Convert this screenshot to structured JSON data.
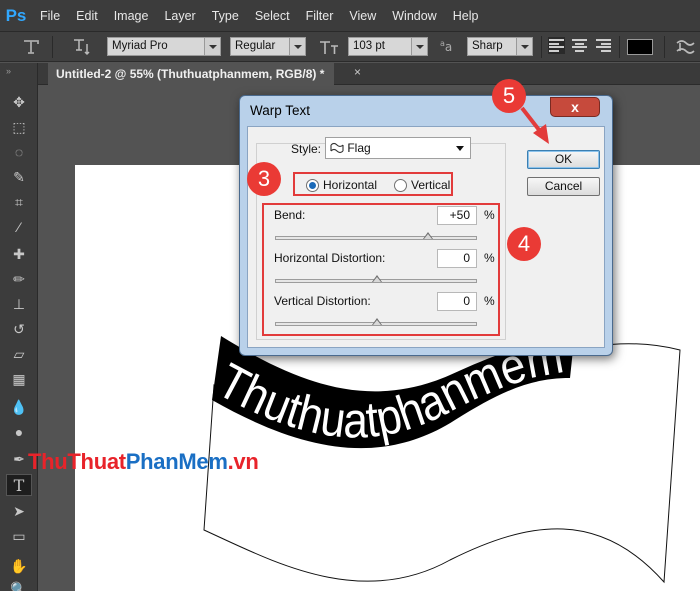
{
  "app": {
    "logo": "Ps"
  },
  "menu": [
    "File",
    "Edit",
    "Image",
    "Layer",
    "Type",
    "Select",
    "Filter",
    "View",
    "Window",
    "Help"
  ],
  "options_bar": {
    "font_family": "Myriad Pro",
    "font_style": "Regular",
    "font_size": "103 pt",
    "aa_label": "a",
    "anti_alias": "Sharp",
    "text_color": "#000000"
  },
  "document_tab": {
    "title": "Untitled-2 @ 55% (Thuthuatphanmem, RGB/8) *",
    "close": "×"
  },
  "artwork": {
    "warped_text": "Thuthuatphanmem"
  },
  "watermark": {
    "part1": "ThuThuat",
    "part2": "PhanMem",
    "part3": ".vn"
  },
  "dialog": {
    "title": "Warp Text",
    "close": "x",
    "style_label": "Style:",
    "style_value": "Flag",
    "orientation": {
      "horizontal": "Horizontal",
      "vertical": "Vertical",
      "selected": "horizontal"
    },
    "bend": {
      "label": "Bend:",
      "value": "+50",
      "unit": "%",
      "slider_fraction": 0.75
    },
    "h_distortion": {
      "label": "Horizontal Distortion:",
      "value": "0",
      "unit": "%",
      "slider_fraction": 0.5
    },
    "v_distortion": {
      "label": "Vertical Distortion:",
      "value": "0",
      "unit": "%",
      "slider_fraction": 0.5
    },
    "ok": "OK",
    "cancel": "Cancel"
  },
  "annotations": {
    "step3": "3",
    "step4": "4",
    "step5": "5",
    "color": "#e23b3b"
  }
}
